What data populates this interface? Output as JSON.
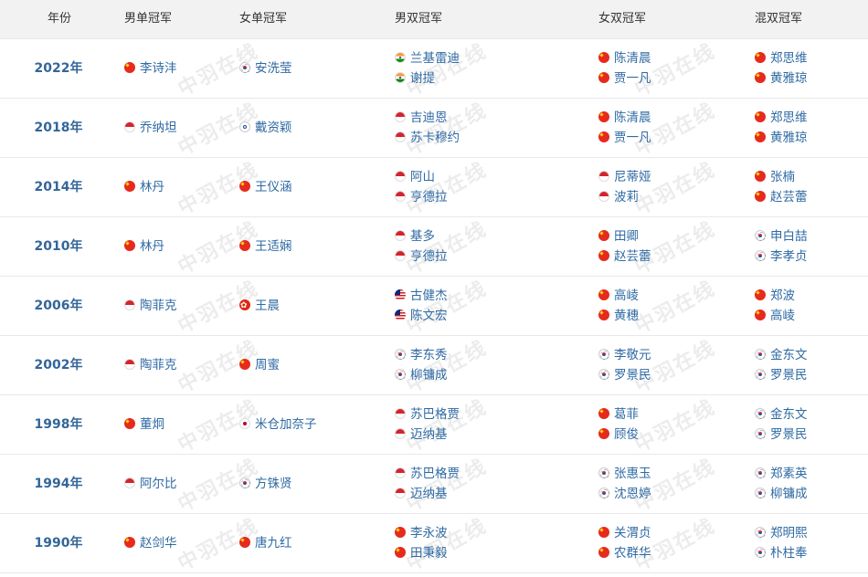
{
  "header": {
    "year": "年份",
    "ms": "男单冠军",
    "ws": "女单冠军",
    "md": "男双冠军",
    "wd": "女双冠军",
    "xd": "混双冠军"
  },
  "rows": [
    {
      "year": "2022年",
      "ms": [
        {
          "flag": "cn",
          "name": "李诗沣"
        }
      ],
      "ws": [
        {
          "flag": "kr",
          "name": "安洗莹"
        }
      ],
      "md": [
        {
          "flag": "in",
          "name": "兰基雷迪"
        },
        {
          "flag": "in",
          "name": "谢提"
        }
      ],
      "wd": [
        {
          "flag": "cn",
          "name": "陈清晨"
        },
        {
          "flag": "cn",
          "name": "贾一凡"
        }
      ],
      "xd": [
        {
          "flag": "cn",
          "name": "郑思维"
        },
        {
          "flag": "cn",
          "name": "黄雅琼"
        }
      ]
    },
    {
      "year": "2018年",
      "ms": [
        {
          "flag": "id",
          "name": "乔纳坦"
        }
      ],
      "ws": [
        {
          "flag": "tw",
          "name": "戴资颖"
        }
      ],
      "md": [
        {
          "flag": "id",
          "name": "吉迪恩"
        },
        {
          "flag": "id",
          "name": "苏卡穆约"
        }
      ],
      "wd": [
        {
          "flag": "cn",
          "name": "陈清晨"
        },
        {
          "flag": "cn",
          "name": "贾一凡"
        }
      ],
      "xd": [
        {
          "flag": "cn",
          "name": "郑思维"
        },
        {
          "flag": "cn",
          "name": "黄雅琼"
        }
      ]
    },
    {
      "year": "2014年",
      "ms": [
        {
          "flag": "cn",
          "name": "林丹"
        }
      ],
      "ws": [
        {
          "flag": "cn",
          "name": "王仪涵"
        }
      ],
      "md": [
        {
          "flag": "id",
          "name": "阿山"
        },
        {
          "flag": "id",
          "name": "亨德拉"
        }
      ],
      "wd": [
        {
          "flag": "id",
          "name": "尼蒂娅"
        },
        {
          "flag": "id",
          "name": "波莉"
        }
      ],
      "xd": [
        {
          "flag": "cn",
          "name": "张楠"
        },
        {
          "flag": "cn",
          "name": "赵芸蕾"
        }
      ]
    },
    {
      "year": "2010年",
      "ms": [
        {
          "flag": "cn",
          "name": "林丹"
        }
      ],
      "ws": [
        {
          "flag": "cn",
          "name": "王适娴"
        }
      ],
      "md": [
        {
          "flag": "id",
          "name": "基多"
        },
        {
          "flag": "id",
          "name": "亨德拉"
        }
      ],
      "wd": [
        {
          "flag": "cn",
          "name": "田卿"
        },
        {
          "flag": "cn",
          "name": "赵芸蕾"
        }
      ],
      "xd": [
        {
          "flag": "kr",
          "name": "申白喆"
        },
        {
          "flag": "kr",
          "name": "李孝贞"
        }
      ]
    },
    {
      "year": "2006年",
      "ms": [
        {
          "flag": "id",
          "name": "陶菲克"
        }
      ],
      "ws": [
        {
          "flag": "hk",
          "name": "王晨"
        }
      ],
      "md": [
        {
          "flag": "my",
          "name": "古健杰"
        },
        {
          "flag": "my",
          "name": "陈文宏"
        }
      ],
      "wd": [
        {
          "flag": "cn",
          "name": "高崚"
        },
        {
          "flag": "cn",
          "name": "黄穗"
        }
      ],
      "xd": [
        {
          "flag": "cn",
          "name": "郑波"
        },
        {
          "flag": "cn",
          "name": "高崚"
        }
      ]
    },
    {
      "year": "2002年",
      "ms": [
        {
          "flag": "id",
          "name": "陶菲克"
        }
      ],
      "ws": [
        {
          "flag": "cn",
          "name": "周蜜"
        }
      ],
      "md": [
        {
          "flag": "kr",
          "name": "李东秀"
        },
        {
          "flag": "kr",
          "name": "柳镛成"
        }
      ],
      "wd": [
        {
          "flag": "kr",
          "name": "李敬元"
        },
        {
          "flag": "kr",
          "name": "罗景民"
        }
      ],
      "xd": [
        {
          "flag": "kr",
          "name": "金东文"
        },
        {
          "flag": "kr",
          "name": "罗景民"
        }
      ]
    },
    {
      "year": "1998年",
      "ms": [
        {
          "flag": "cn",
          "name": "董炯"
        }
      ],
      "ws": [
        {
          "flag": "jp",
          "name": "米仓加奈子"
        }
      ],
      "md": [
        {
          "flag": "id",
          "name": "苏巴格贾"
        },
        {
          "flag": "id",
          "name": "迈纳基"
        }
      ],
      "wd": [
        {
          "flag": "cn",
          "name": "葛菲"
        },
        {
          "flag": "cn",
          "name": "顾俊"
        }
      ],
      "xd": [
        {
          "flag": "kr",
          "name": "金东文"
        },
        {
          "flag": "kr",
          "name": "罗景民"
        }
      ]
    },
    {
      "year": "1994年",
      "ms": [
        {
          "flag": "id",
          "name": "阿尔比"
        }
      ],
      "ws": [
        {
          "flag": "kr",
          "name": "方铢贤"
        }
      ],
      "md": [
        {
          "flag": "id",
          "name": "苏巴格贾"
        },
        {
          "flag": "id",
          "name": "迈纳基"
        }
      ],
      "wd": [
        {
          "flag": "kr",
          "name": "张惠玉"
        },
        {
          "flag": "kr",
          "name": "沈恩婷"
        }
      ],
      "xd": [
        {
          "flag": "kr",
          "name": "郑素英"
        },
        {
          "flag": "kr",
          "name": "柳镛成"
        }
      ]
    },
    {
      "year": "1990年",
      "ms": [
        {
          "flag": "cn",
          "name": "赵剑华"
        }
      ],
      "ws": [
        {
          "flag": "cn",
          "name": "唐九红"
        }
      ],
      "md": [
        {
          "flag": "cn",
          "name": "李永波"
        },
        {
          "flag": "cn",
          "name": "田秉毅"
        }
      ],
      "wd": [
        {
          "flag": "cn",
          "name": "关渭贞"
        },
        {
          "flag": "cn",
          "name": "农群华"
        }
      ],
      "xd": [
        {
          "flag": "kr",
          "name": "郑明熙"
        },
        {
          "flag": "kr",
          "name": "朴柱奉"
        }
      ]
    }
  ],
  "watermark": "中羽在线"
}
